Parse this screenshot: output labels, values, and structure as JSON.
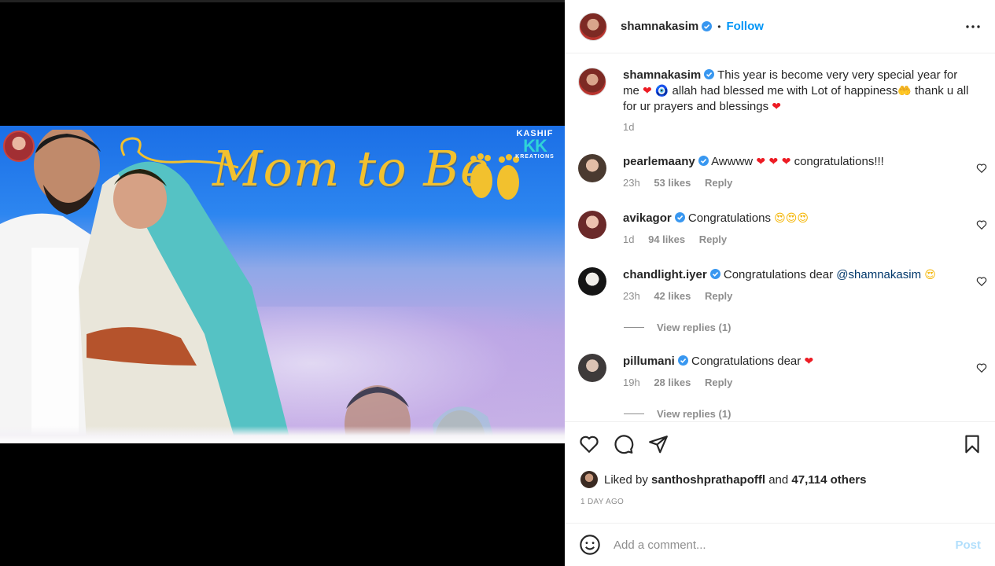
{
  "post": {
    "image_title": "Mom to Be",
    "image_logo_top": "KASHIF",
    "image_logo_mark": "KK",
    "image_logo_sub": "KREATIONS"
  },
  "header": {
    "username": "shamnakasim",
    "separator": "•",
    "follow_label": "Follow"
  },
  "caption": {
    "username": "shamnakasim",
    "text_part1": "This year is become very very special year for me",
    "emoji1": "❤",
    "emoji2": "🧿",
    "text_part2": "allah had blessed me with Lot of happiness",
    "emoji3": "🤲",
    "text_part3": "thank u all for ur prayers and blessings",
    "emoji4": "❤",
    "time": "1d"
  },
  "comments": [
    {
      "username": "pearlemaany",
      "text": "Awwww",
      "emoji": "❤ ❤ ❤",
      "text_after": "congratulations!!!",
      "time": "23h",
      "likes": "53 likes",
      "reply": "Reply"
    },
    {
      "username": "avikagor",
      "text": "Congratulations",
      "emoji": "😍😍😍",
      "text_after": "",
      "time": "1d",
      "likes": "94 likes",
      "reply": "Reply"
    },
    {
      "username": "chandlight.iyer",
      "text": "Congratulations dear",
      "mention": "@shamnakasim",
      "emoji": "😍",
      "text_after": "",
      "time": "23h",
      "likes": "42 likes",
      "reply": "Reply",
      "view_replies": "View replies (1)"
    },
    {
      "username": "pillumani",
      "text": "Congratulations dear",
      "emoji": "❤",
      "text_after": "",
      "time": "19h",
      "likes": "28 likes",
      "reply": "Reply",
      "view_replies": "View replies (1)"
    }
  ],
  "likes": {
    "prefix": "Liked by",
    "user": "santhoshprathapoffl",
    "and": "and",
    "others": "47,114 others"
  },
  "timestamp": "1 DAY AGO",
  "add_comment": {
    "placeholder": "Add a comment...",
    "post_label": "Post"
  },
  "colors": {
    "accent": "#0095f6",
    "verified": "#3897f0",
    "muted": "#8e8e8e",
    "post_disabled": "#b2dffc"
  }
}
